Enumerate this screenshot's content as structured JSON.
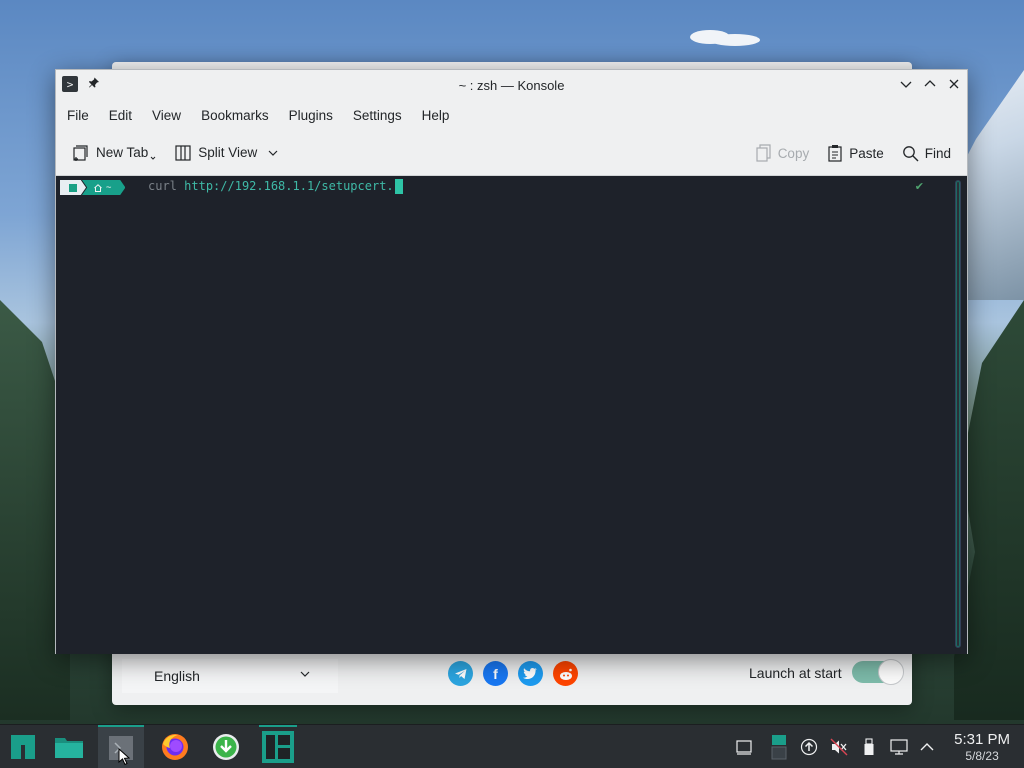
{
  "window": {
    "title": "~ : zsh — Konsole"
  },
  "menu": [
    "File",
    "Edit",
    "View",
    "Bookmarks",
    "Plugins",
    "Settings",
    "Help"
  ],
  "toolbar": {
    "new_tab": "New Tab",
    "split_view": "Split View",
    "copy": "Copy",
    "paste": "Paste",
    "find": "Find"
  },
  "terminal": {
    "prompt_dir": "~",
    "command": "curl",
    "argument": "http://192.168.1.1/setupcert.",
    "status_mark": "✔"
  },
  "background_app": {
    "language": "English",
    "launch_at_start_label": "Launch at start",
    "launch_at_start_on": true,
    "social": [
      {
        "name": "telegram-icon",
        "color": "#2ca5e0"
      },
      {
        "name": "facebook-icon",
        "color": "#1877f2"
      },
      {
        "name": "twitter-icon",
        "color": "#1d9bf0"
      },
      {
        "name": "reddit-icon",
        "color": "#ff4500"
      }
    ]
  },
  "taskbar": {
    "time": "5:31 PM",
    "date": "5/8/23",
    "accent": "#1a9e8a"
  }
}
